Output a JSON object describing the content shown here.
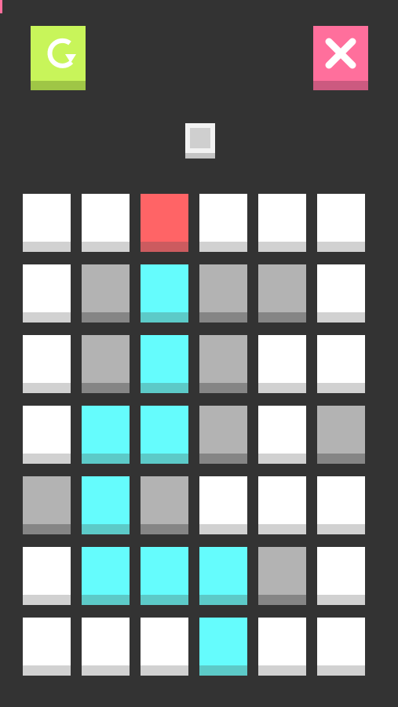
{
  "controls": {
    "restart_icon": "restart-arrow-icon",
    "close_icon": "close-x-icon",
    "restart_color": "#c8f55a",
    "close_color": "#ff6f9c"
  },
  "level_indicator": {
    "icon": "level-tile-icon",
    "marker_color": "#ff6f9c"
  },
  "board": {
    "rows": 7,
    "cols": 6,
    "colors": {
      "white": "#ffffff",
      "gray": "#b3b3b3",
      "cyan": "#65fcfd",
      "red": "#ff6466"
    },
    "grid": [
      [
        "white",
        "white",
        "red",
        "white",
        "white",
        "white"
      ],
      [
        "white",
        "gray",
        "cyan",
        "gray",
        "gray",
        "white"
      ],
      [
        "white",
        "gray",
        "cyan",
        "gray",
        "white",
        "white"
      ],
      [
        "white",
        "cyan",
        "cyan",
        "gray",
        "white",
        "gray"
      ],
      [
        "gray",
        "cyan",
        "gray",
        "white",
        "white",
        "white"
      ],
      [
        "white",
        "cyan",
        "cyan",
        "cyan",
        "gray",
        "white"
      ],
      [
        "white",
        "white",
        "white",
        "cyan",
        "white",
        "white"
      ]
    ]
  }
}
